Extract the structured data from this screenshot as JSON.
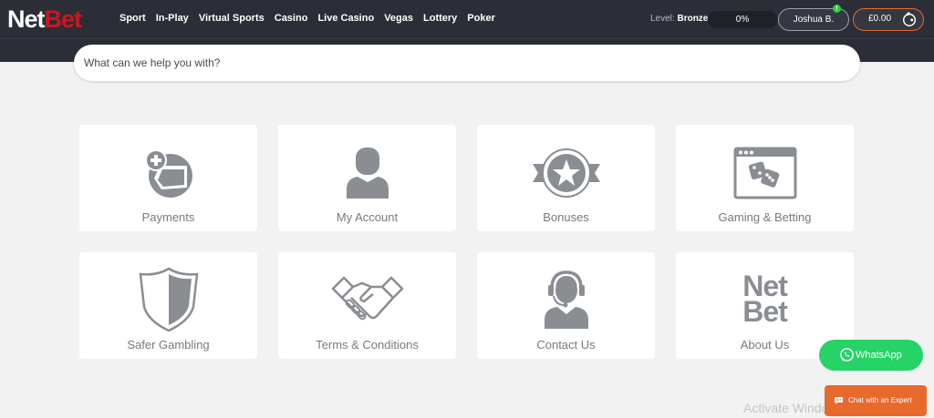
{
  "header": {
    "logo": {
      "part1": "Net",
      "part2": "Bet"
    },
    "nav": [
      "Sport",
      "In-Play",
      "Virtual Sports",
      "Casino",
      "Live Casino",
      "Vegas",
      "Lottery",
      "Poker"
    ],
    "level_label": "Level:",
    "level_value": "Bronze",
    "progress": "0%",
    "user_name": "Joshua B.",
    "notification_count": "!",
    "balance": "£0.00"
  },
  "search": {
    "placeholder": "What can we help you with?"
  },
  "cards": [
    {
      "label": "Payments",
      "icon": "payments-icon"
    },
    {
      "label": "My Account",
      "icon": "user-icon"
    },
    {
      "label": "Bonuses",
      "icon": "star-badge-icon"
    },
    {
      "label": "Gaming & Betting",
      "icon": "dice-window-icon"
    },
    {
      "label": "Safer Gambling",
      "icon": "shield-icon"
    },
    {
      "label": "Terms & Conditions",
      "icon": "handshake-icon"
    },
    {
      "label": "Contact Us",
      "icon": "headset-agent-icon"
    },
    {
      "label": "About Us",
      "icon": "netbet-logo-icon",
      "logo_line1": "Net",
      "logo_line2": "Bet"
    }
  ],
  "whatsapp_label": "WhatsApp",
  "chat_label": "Chat with an Expert",
  "watermark": "Activate Windows",
  "colors": {
    "nav_bg": "#2b2e36",
    "brand_red": "#d0141e",
    "accent_orange": "#e8692c",
    "whatsapp_green": "#25d366",
    "icon_gray": "#8a8e93"
  }
}
